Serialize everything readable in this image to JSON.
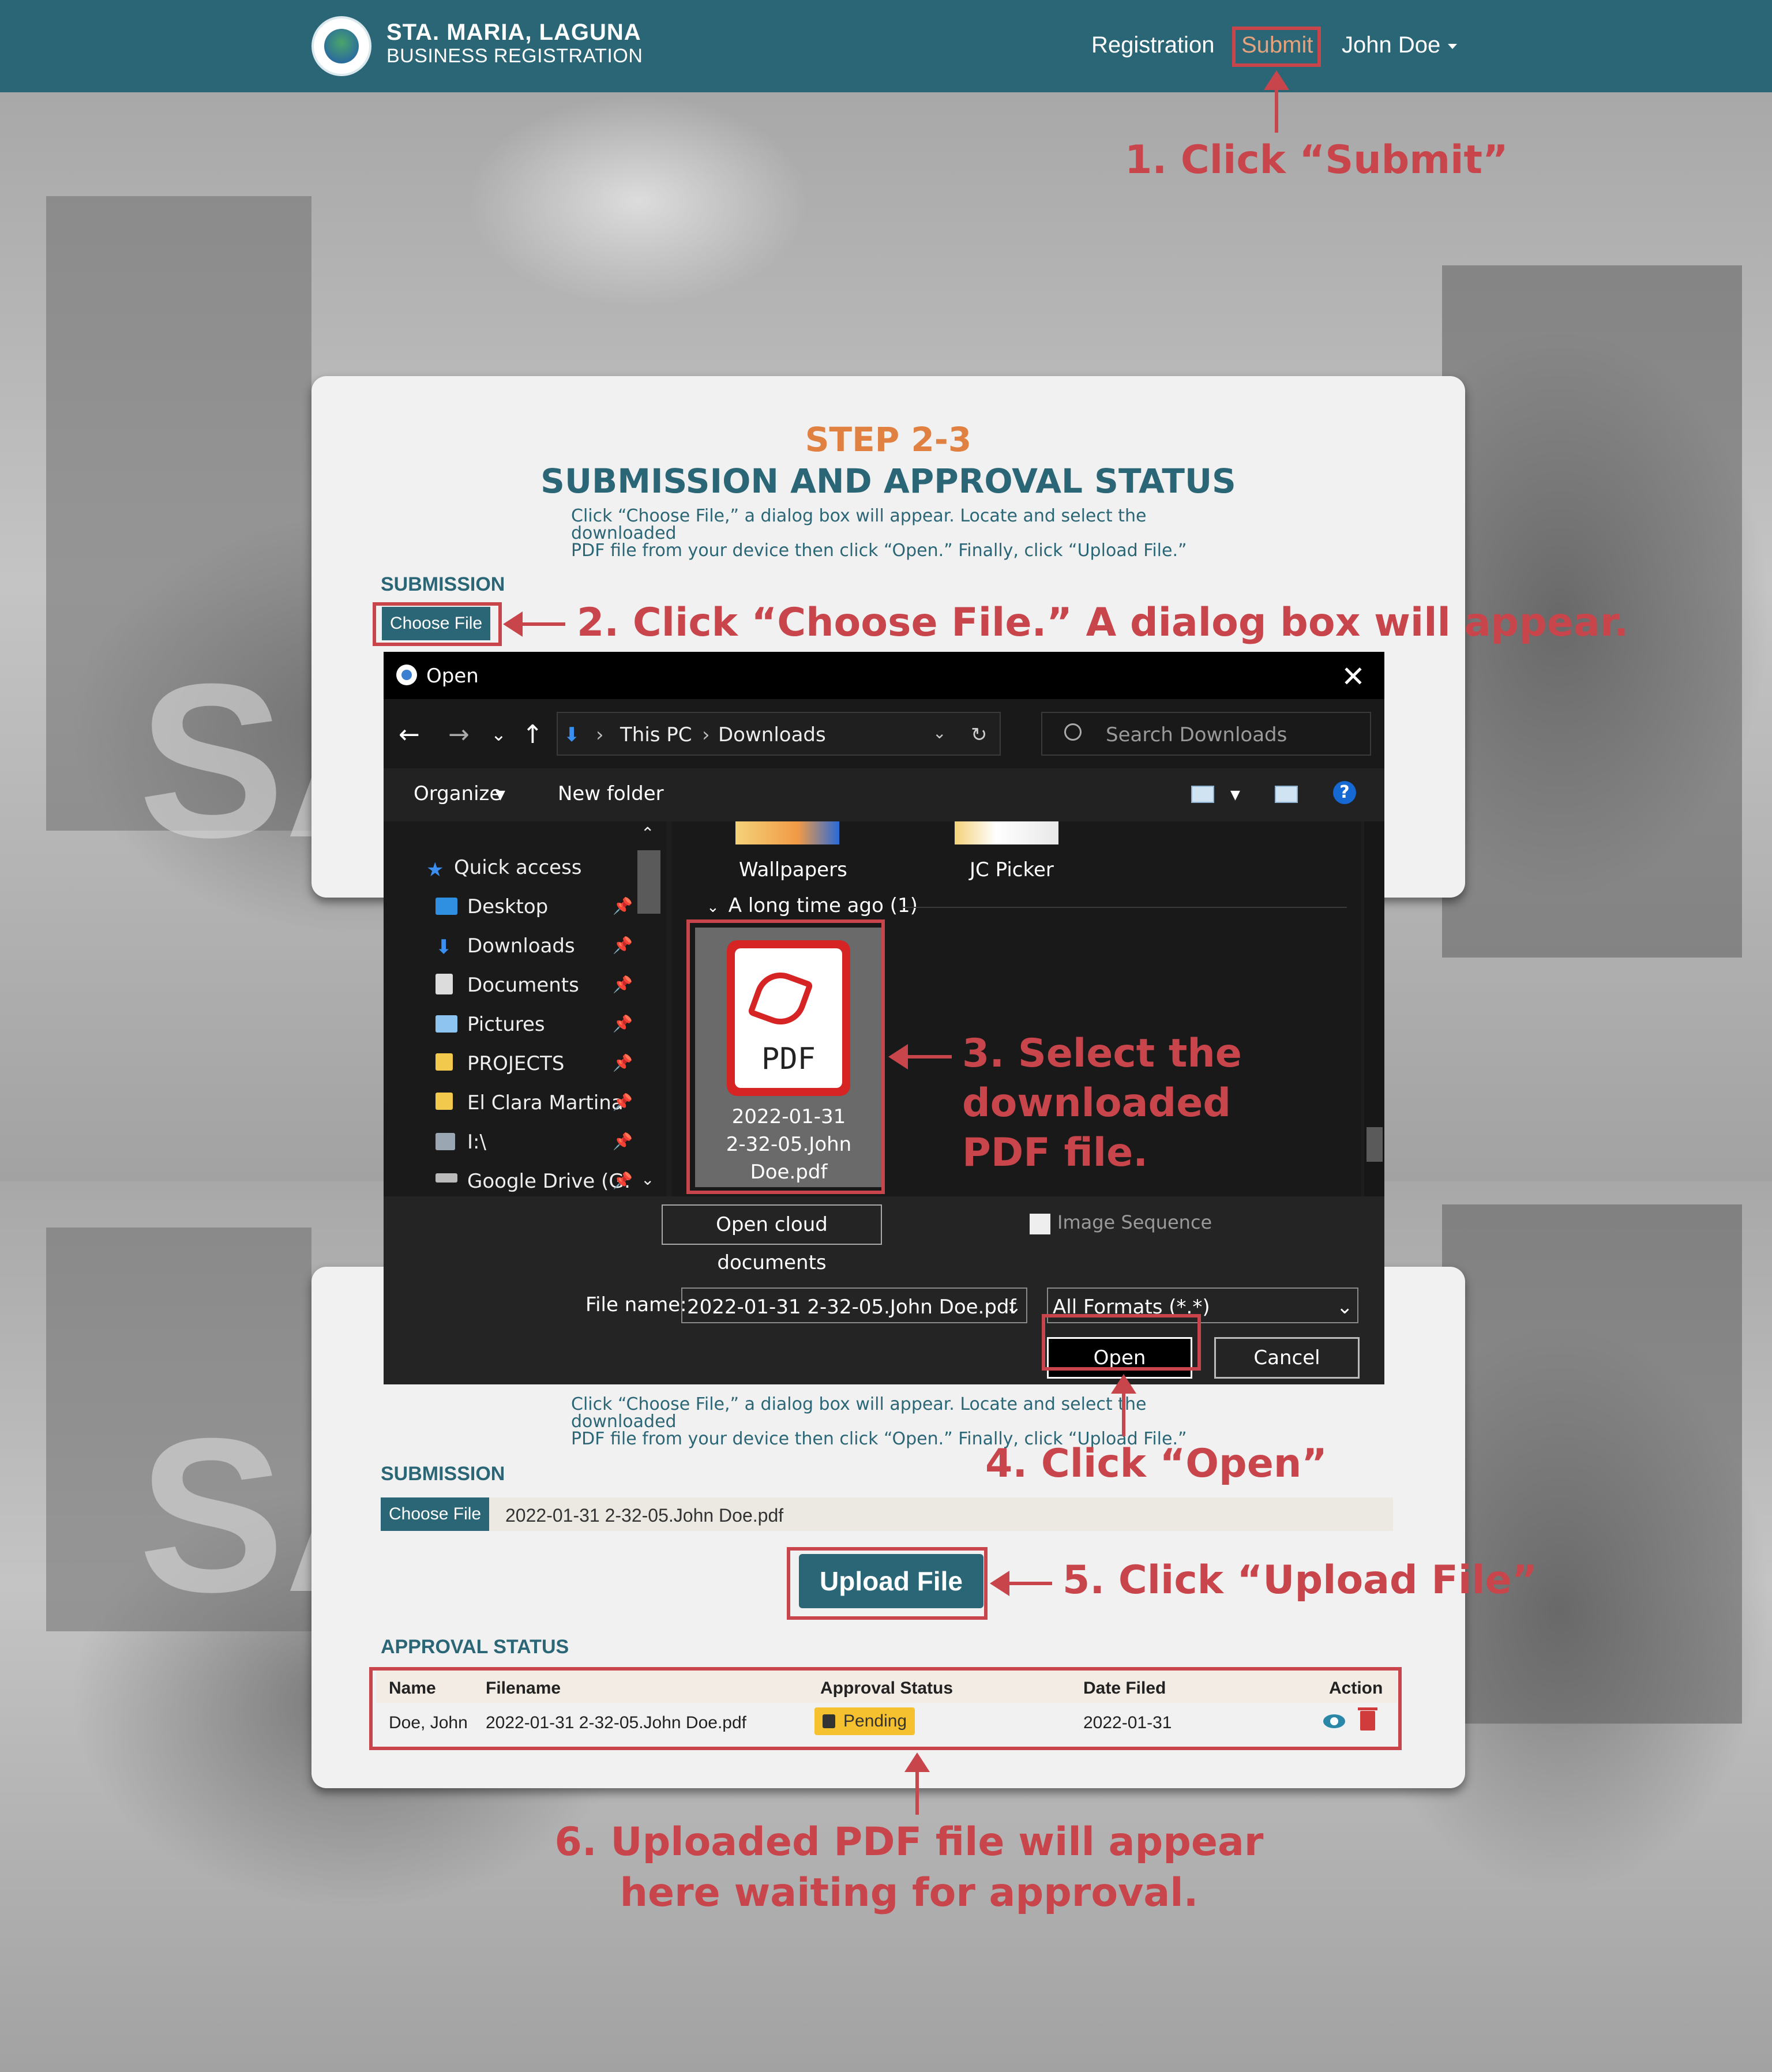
{
  "header": {
    "brand_line1": "STA. MARIA, LAGUNA",
    "brand_line2": "BUSINESS REGISTRATION",
    "nav": {
      "registration": "Registration",
      "submit": "Submit",
      "user": "John Doe"
    }
  },
  "card_top": {
    "step": "STEP 2-3",
    "title": "SUBMISSION AND APPROVAL STATUS",
    "desc_line1": "Click “Choose File,” a dialog box will appear. Locate and select the downloaded",
    "desc_line2": "PDF file from your device then click “Open.” Finally, click “Upload File.”",
    "section_submission": "SUBMISSION",
    "choose_file": "Choose File"
  },
  "card_bottom": {
    "desc_line1": "Click “Choose File,” a dialog box will appear. Locate and select the downloaded",
    "desc_line2": "PDF file from your device then click “Open.” Finally, click “Upload File.”",
    "section_submission": "SUBMISSION",
    "choose_file": "Choose File",
    "chosen_file": "2022-01-31 2-32-05.John Doe.pdf",
    "upload_button": "Upload File",
    "section_approval": "APPROVAL STATUS",
    "table": {
      "headers": [
        "Name",
        "Filename",
        "Approval Status",
        "Date Filed",
        "Action"
      ],
      "row": {
        "name": "Doe, John",
        "filename": "2022-01-31 2-32-05.John Doe.pdf",
        "status": "Pending",
        "date": "2022-01-31"
      }
    }
  },
  "dialog": {
    "title": "Open",
    "path": [
      "This PC",
      "Downloads"
    ],
    "search_placeholder": "Search Downloads",
    "toolbar": {
      "organize": "Organize",
      "new_folder": "New folder",
      "help": "?"
    },
    "sidebar": [
      {
        "label": "Quick access",
        "icon": "star-icon"
      },
      {
        "label": "Desktop",
        "icon": "desktop-icon"
      },
      {
        "label": "Downloads",
        "icon": "download-icon"
      },
      {
        "label": "Documents",
        "icon": "document-icon"
      },
      {
        "label": "Pictures",
        "icon": "pictures-icon"
      },
      {
        "label": "PROJECTS",
        "icon": "folder-icon"
      },
      {
        "label": "El Clara Martina",
        "icon": "folder-icon"
      },
      {
        "label": "I:\\",
        "icon": "drive-icon"
      },
      {
        "label": "Google Drive (G:",
        "icon": "drive-icon"
      }
    ],
    "folders": [
      "Wallpapers",
      "JC Picker"
    ],
    "group_header": "A long time ago (1)",
    "file": {
      "line1": "2022-01-31",
      "line2": "2-32-05.John",
      "line3": "Doe.pdf",
      "icon_label": "PDF"
    },
    "open_cloud": "Open cloud documents",
    "image_sequence": "Image Sequence",
    "file_name_label": "File name:",
    "file_name_value": "2022-01-31 2-32-05.John Doe.pdf",
    "format": "All Formats (*.*)",
    "open_button": "Open",
    "cancel_button": "Cancel"
  },
  "annotations": {
    "a1": "1. Click “Submit”",
    "a2": "2. Click “Choose File.” A dialog box will appear.",
    "a3_line1": "3. Select the",
    "a3_line2": "downloaded",
    "a3_line3": "PDF file.",
    "a4": "4. Click “Open”",
    "a5": "5. Click “Upload File”",
    "a6_line1": "6. Uploaded PDF file will appear",
    "a6_line2": "here waiting for approval."
  },
  "colors": {
    "nav": "#2b6676",
    "accent_orange": "#e08142",
    "annotation_red": "#c8464b",
    "pending": "#f6c12f"
  }
}
